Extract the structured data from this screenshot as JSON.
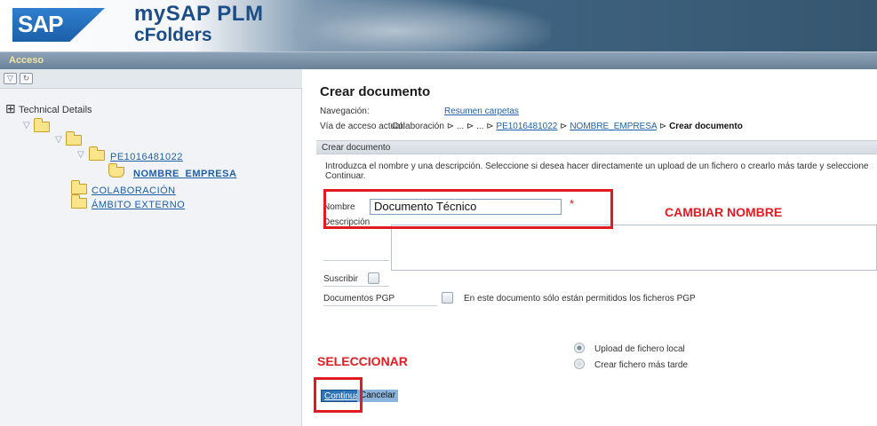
{
  "header": {
    "logo_text": "SAP",
    "product_title": "mySAP PLM",
    "product_subtitle": "cFolders"
  },
  "navbar": {
    "label": "Acceso"
  },
  "left_panel": {
    "toolbar_icons": [
      "tree-collapse-icon",
      "tree-refresh-icon"
    ],
    "tree": {
      "root_label": "Technical Details",
      "node_pe": "PE1016481022",
      "node_empresa": "NOMBRE_EMPRESA",
      "node_colaboracion": "COLABORACIÓN",
      "node_ambito": "ÁMBITO EXTERNO"
    }
  },
  "content": {
    "title": "Crear documento",
    "navegacion_label": "Navegación:",
    "navegacion_link": "Resumen carpetas",
    "via_label": "Vía de acceso actual:",
    "breadcrumb": {
      "part1": "Colaboración ⊳ ... ⊳ ... ⊳ ",
      "link1": "PE1016481022",
      "sep1": " ⊳ ",
      "link2": "NOMBRE_EMPRESA",
      "sep2": " ⊳ ",
      "current": "Crear documento"
    },
    "section_title": "Crear documento",
    "instructions": "Introduzca el nombre y una descripción. Seleccione si desea hacer directamente un upload de un fichero o crearlo más tarde y seleccione Continuar.",
    "nombre_label": "Nombre",
    "nombre_value": "Documento Técnico",
    "descripcion_label": "Descripción",
    "suscribir_label": "Suscribir",
    "pgp_label": "Documentos PGP",
    "pgp_note": "En este documento sólo están permitidos los ficheros PGP",
    "radio_upload": "Upload de fichero local",
    "radio_later": "Crear fichero más tarde",
    "continuar": "Continuar",
    "cancelar": "Cancelar"
  },
  "annotations": {
    "cambiar_nombre": "CAMBIAR NOMBRE",
    "seleccionar": "SELECCIONAR",
    "color": "#e21b23"
  }
}
